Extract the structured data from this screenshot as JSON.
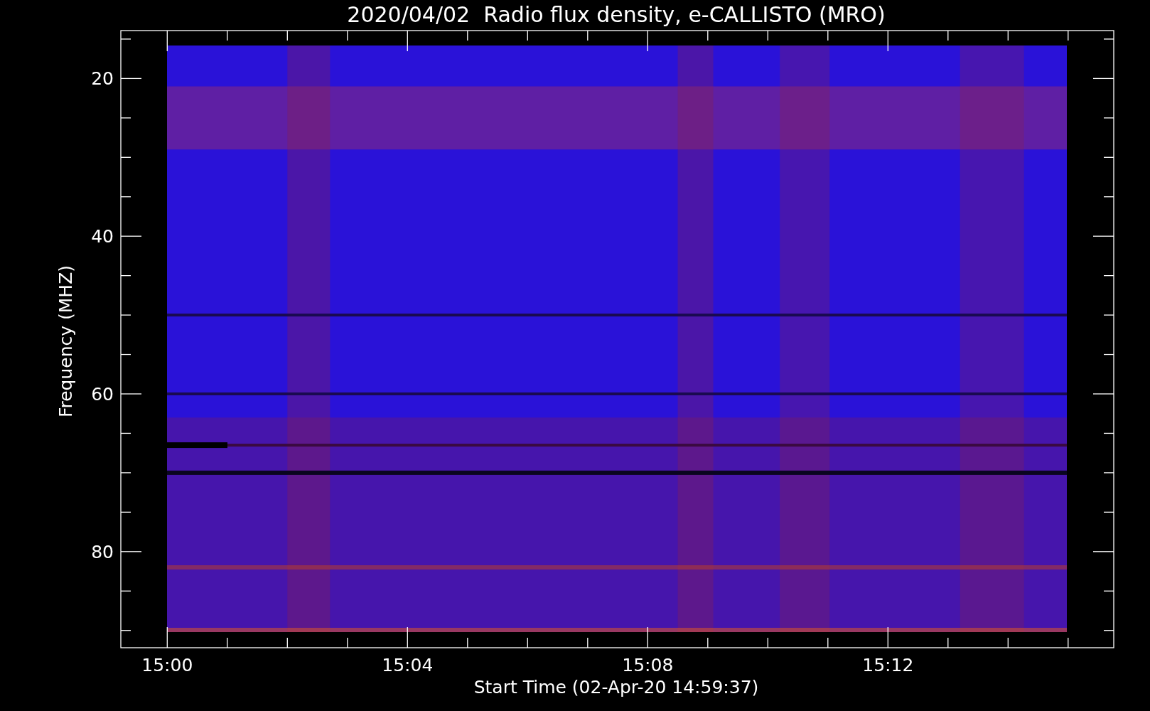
{
  "plot": {
    "title": "2020/04/02  Radio flux density, e-CALLISTO (MRO)",
    "ylabel": "Frequency (MHZ)",
    "xlabel": "Start Time (02-Apr-20 14:59:37)",
    "yticks": [
      "20",
      "40",
      "60",
      "80"
    ],
    "xticks": [
      "15:00",
      "15:04",
      "15:08",
      "15:12"
    ]
  }
}
